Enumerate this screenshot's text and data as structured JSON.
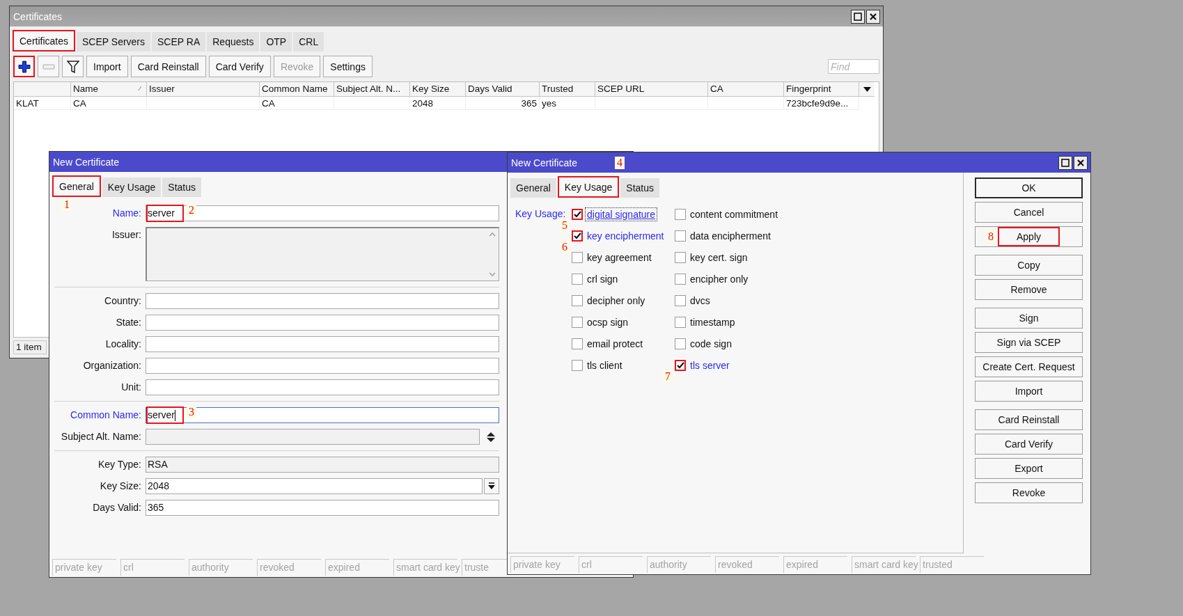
{
  "certificates_window": {
    "title": "Certificates",
    "tabs": [
      {
        "label": "Certificates",
        "selected": true,
        "highlighted": true
      },
      {
        "label": "SCEP Servers",
        "selected": false,
        "highlighted": false
      },
      {
        "label": "SCEP RA",
        "selected": false,
        "highlighted": false
      },
      {
        "label": "Requests",
        "selected": false,
        "highlighted": false
      },
      {
        "label": "OTP",
        "selected": false,
        "highlighted": false
      },
      {
        "label": "CRL",
        "selected": false,
        "highlighted": false
      }
    ],
    "toolbar": [
      {
        "kind": "add",
        "disabled": false,
        "highlighted": true
      },
      {
        "kind": "remove",
        "disabled": true,
        "highlighted": false
      },
      {
        "kind": "filter",
        "disabled": false,
        "highlighted": false
      },
      {
        "kind": "text",
        "label": "Import",
        "disabled": false,
        "highlighted": false
      },
      {
        "kind": "text",
        "label": "Card Reinstall",
        "disabled": false,
        "highlighted": false
      },
      {
        "kind": "text",
        "label": "Card Verify",
        "disabled": false,
        "highlighted": false
      },
      {
        "kind": "text",
        "label": "Revoke",
        "disabled": true,
        "highlighted": false
      },
      {
        "kind": "text",
        "label": "Settings",
        "disabled": false,
        "highlighted": false
      }
    ],
    "find": {
      "placeholder": "Find"
    },
    "table": {
      "columns": [
        {
          "sorted": false
        },
        {
          "label": "Name",
          "sorted": true
        },
        {
          "label": "Issuer",
          "sorted": false
        },
        {
          "label": "Common Name",
          "sorted": false
        },
        {
          "label": "Subject Alt. N...",
          "sorted": false
        },
        {
          "label": "Key Size",
          "sorted": false
        },
        {
          "label": "Days Valid",
          "sorted": false
        },
        {
          "label": "Trusted",
          "sorted": false
        },
        {
          "label": "SCEP URL",
          "sorted": false
        },
        {
          "label": "CA",
          "sorted": false
        },
        {
          "label": "Fingerprint",
          "sorted": false
        }
      ],
      "rows": [
        {
          "cells": [
            {
              "text": "KLAT"
            },
            {
              "text": "CA"
            },
            {},
            {
              "text": "CA"
            },
            {},
            {
              "text": "2048"
            },
            {
              "text": "365"
            },
            {
              "text": "yes"
            },
            {},
            {},
            {
              "text": "723bcfe9d9e..."
            }
          ]
        }
      ]
    },
    "status_bar": "1 item"
  },
  "general_window": {
    "title": "New Certificate",
    "tabs": [
      {
        "label": "General",
        "selected": true,
        "highlighted": true,
        "marker": "1"
      },
      {
        "label": "Key Usage",
        "selected": false,
        "highlighted": false
      },
      {
        "label": "Status",
        "selected": false,
        "highlighted": false
      }
    ],
    "fields": [
      {
        "kind": "text",
        "label": "Name:",
        "value": "server",
        "emphasized": true,
        "disabled": false,
        "highlighted": true,
        "focused": false,
        "marker": "2"
      },
      {
        "kind": "textarea",
        "label": "Issuer:",
        "emphasized": false,
        "disabled": true,
        "highlighted": false,
        "focused": false
      },
      {
        "kind": "divider"
      },
      {
        "kind": "text",
        "label": "Country:",
        "emphasized": false,
        "disabled": false,
        "highlighted": false,
        "focused": false
      },
      {
        "kind": "text",
        "label": "State:",
        "emphasized": false,
        "disabled": false,
        "highlighted": false,
        "focused": false
      },
      {
        "kind": "text",
        "label": "Locality:",
        "emphasized": false,
        "disabled": false,
        "highlighted": false,
        "focused": false
      },
      {
        "kind": "text",
        "label": "Organization:",
        "emphasized": false,
        "disabled": false,
        "highlighted": false,
        "focused": false
      },
      {
        "kind": "text",
        "label": "Unit:",
        "emphasized": false,
        "disabled": false,
        "highlighted": false,
        "focused": false
      },
      {
        "kind": "divider"
      },
      {
        "kind": "text",
        "label": "Common Name:",
        "value": "server",
        "emphasized": true,
        "disabled": false,
        "highlighted": true,
        "focused": true,
        "marker": "3"
      },
      {
        "kind": "list",
        "label": "Subject Alt. Name:",
        "emphasized": false,
        "disabled": true,
        "highlighted": false,
        "focused": false
      },
      {
        "kind": "divider"
      },
      {
        "kind": "text",
        "label": "Key Type:",
        "value": "RSA",
        "emphasized": false,
        "disabled": true,
        "highlighted": false,
        "focused": false
      },
      {
        "kind": "dropdown",
        "label": "Key Size:",
        "value": "2048",
        "emphasized": false,
        "disabled": false,
        "highlighted": false,
        "focused": false
      },
      {
        "kind": "text",
        "label": "Days Valid:",
        "value": "365",
        "emphasized": false,
        "disabled": false,
        "highlighted": false,
        "focused": false
      }
    ],
    "status_bar": [
      "private key",
      "crl",
      "authority",
      "revoked",
      "expired",
      "smart card key",
      "truste"
    ]
  },
  "key_usage_window": {
    "title": "New Certificate",
    "title_marker": "4",
    "tabs": [
      {
        "label": "General",
        "selected": false,
        "highlighted": false
      },
      {
        "label": "Key Usage",
        "selected": true,
        "highlighted": true
      },
      {
        "label": "Status",
        "selected": false,
        "highlighted": false
      }
    ],
    "key_usage": {
      "label": "Key Usage:",
      "options": [
        {
          "label": "digital signature",
          "checked": true,
          "highlighted": true,
          "focused": true,
          "marker": "5"
        },
        {
          "label": "content commitment",
          "checked": false,
          "highlighted": false,
          "focused": false
        },
        {
          "label": "key encipherment",
          "checked": true,
          "highlighted": true,
          "focused": false,
          "marker": "6"
        },
        {
          "label": "data encipherment",
          "checked": false,
          "highlighted": false,
          "focused": false
        },
        {
          "label": "key agreement",
          "checked": false,
          "highlighted": false,
          "focused": false
        },
        {
          "label": "key cert. sign",
          "checked": false,
          "highlighted": false,
          "focused": false
        },
        {
          "label": "crl sign",
          "checked": false,
          "highlighted": false,
          "focused": false
        },
        {
          "label": "encipher only",
          "checked": false,
          "highlighted": false,
          "focused": false
        },
        {
          "label": "decipher only",
          "checked": false,
          "highlighted": false,
          "focused": false
        },
        {
          "label": "dvcs",
          "checked": false,
          "highlighted": false,
          "focused": false
        },
        {
          "label": "ocsp sign",
          "checked": false,
          "highlighted": false,
          "focused": false
        },
        {
          "label": "timestamp",
          "checked": false,
          "highlighted": false,
          "focused": false
        },
        {
          "label": "email protect",
          "checked": false,
          "highlighted": false,
          "focused": false
        },
        {
          "label": "code sign",
          "checked": false,
          "highlighted": false,
          "focused": false
        },
        {
          "label": "tls client",
          "checked": false,
          "highlighted": false,
          "focused": false
        },
        {
          "label": "tls server",
          "checked": true,
          "highlighted": true,
          "focused": false,
          "marker": "7"
        }
      ]
    },
    "button_groups": [
      [
        {
          "label": "OK",
          "default": true,
          "highlighted": false
        },
        {
          "label": "Cancel",
          "default": false,
          "highlighted": false
        },
        {
          "label": "Apply",
          "default": false,
          "highlighted": true,
          "marker": "8"
        }
      ],
      [
        {
          "label": "Copy",
          "default": false,
          "highlighted": false
        },
        {
          "label": "Remove",
          "default": false,
          "highlighted": false
        }
      ],
      [
        {
          "label": "Sign",
          "default": false,
          "highlighted": false
        },
        {
          "label": "Sign via SCEP",
          "default": false,
          "highlighted": false
        },
        {
          "label": "Create Cert. Request",
          "default": false,
          "highlighted": false
        },
        {
          "label": "Import",
          "default": false,
          "highlighted": false
        }
      ],
      [
        {
          "label": "Card Reinstall",
          "default": false,
          "highlighted": false
        },
        {
          "label": "Card Verify",
          "default": false,
          "highlighted": false
        },
        {
          "label": "Export",
          "default": false,
          "highlighted": false
        },
        {
          "label": "Revoke",
          "default": false,
          "highlighted": false
        }
      ]
    ],
    "status_bar": [
      "private key",
      "crl",
      "authority",
      "revoked",
      "expired",
      "smart card key",
      "trusted"
    ]
  }
}
